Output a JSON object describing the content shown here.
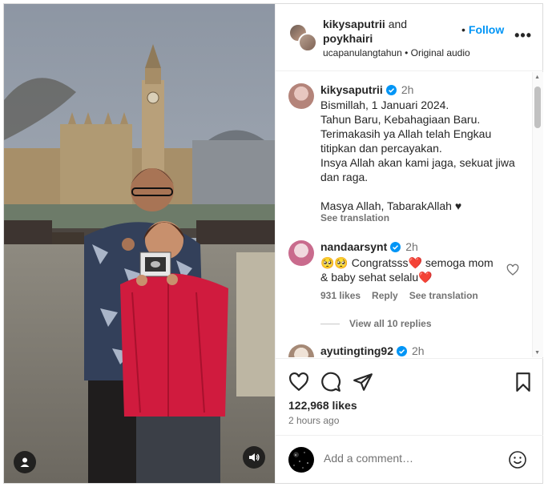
{
  "post": {
    "author": "kikysaputrii",
    "and": "and",
    "coauthor": "poykhairi",
    "follow": "Follow",
    "follow_dot": "•",
    "more": "•••",
    "audio": "ucapanulangtahun • Original audio"
  },
  "caption": {
    "user": "kikysaputrii",
    "time": "2h",
    "text": "Bismillah, 1 Januari 2024.\nTahun Baru, Kebahagiaan Baru.\nTerimakasih ya Allah telah Engkau titipkan dan percayakan.\nInsya Allah akan kami jaga, sekuat jiwa dan raga.\n\nMasya Allah, TabarakAllah ♥",
    "see_translation": "See translation"
  },
  "comments": [
    {
      "user": "nandaarsynt",
      "time": "2h",
      "text": "🥺🥺 Congratsss❤️ semoga mom & baby sehat selalu❤️",
      "likes": "931 likes",
      "reply": "Reply",
      "see_translation": "See translation",
      "view_replies": "View all 10 replies"
    },
    {
      "user": "ayutingting92",
      "time": "2h"
    }
  ],
  "engagement": {
    "likes": "122,968 likes",
    "ago": "2 hours ago"
  },
  "add_comment": {
    "placeholder": "Add a comment…"
  },
  "icons": {
    "like": "heart-icon",
    "comment": "comment-icon",
    "share": "paper-plane-icon",
    "save": "bookmark-icon",
    "emoji": "smiley-icon",
    "tag": "user-tag-icon",
    "sound": "speaker-icon",
    "verified": "verified-badge-icon"
  },
  "colors": {
    "accent": "#0095f6",
    "verified": "#0095f6",
    "text": "#262626",
    "muted": "#737373"
  }
}
